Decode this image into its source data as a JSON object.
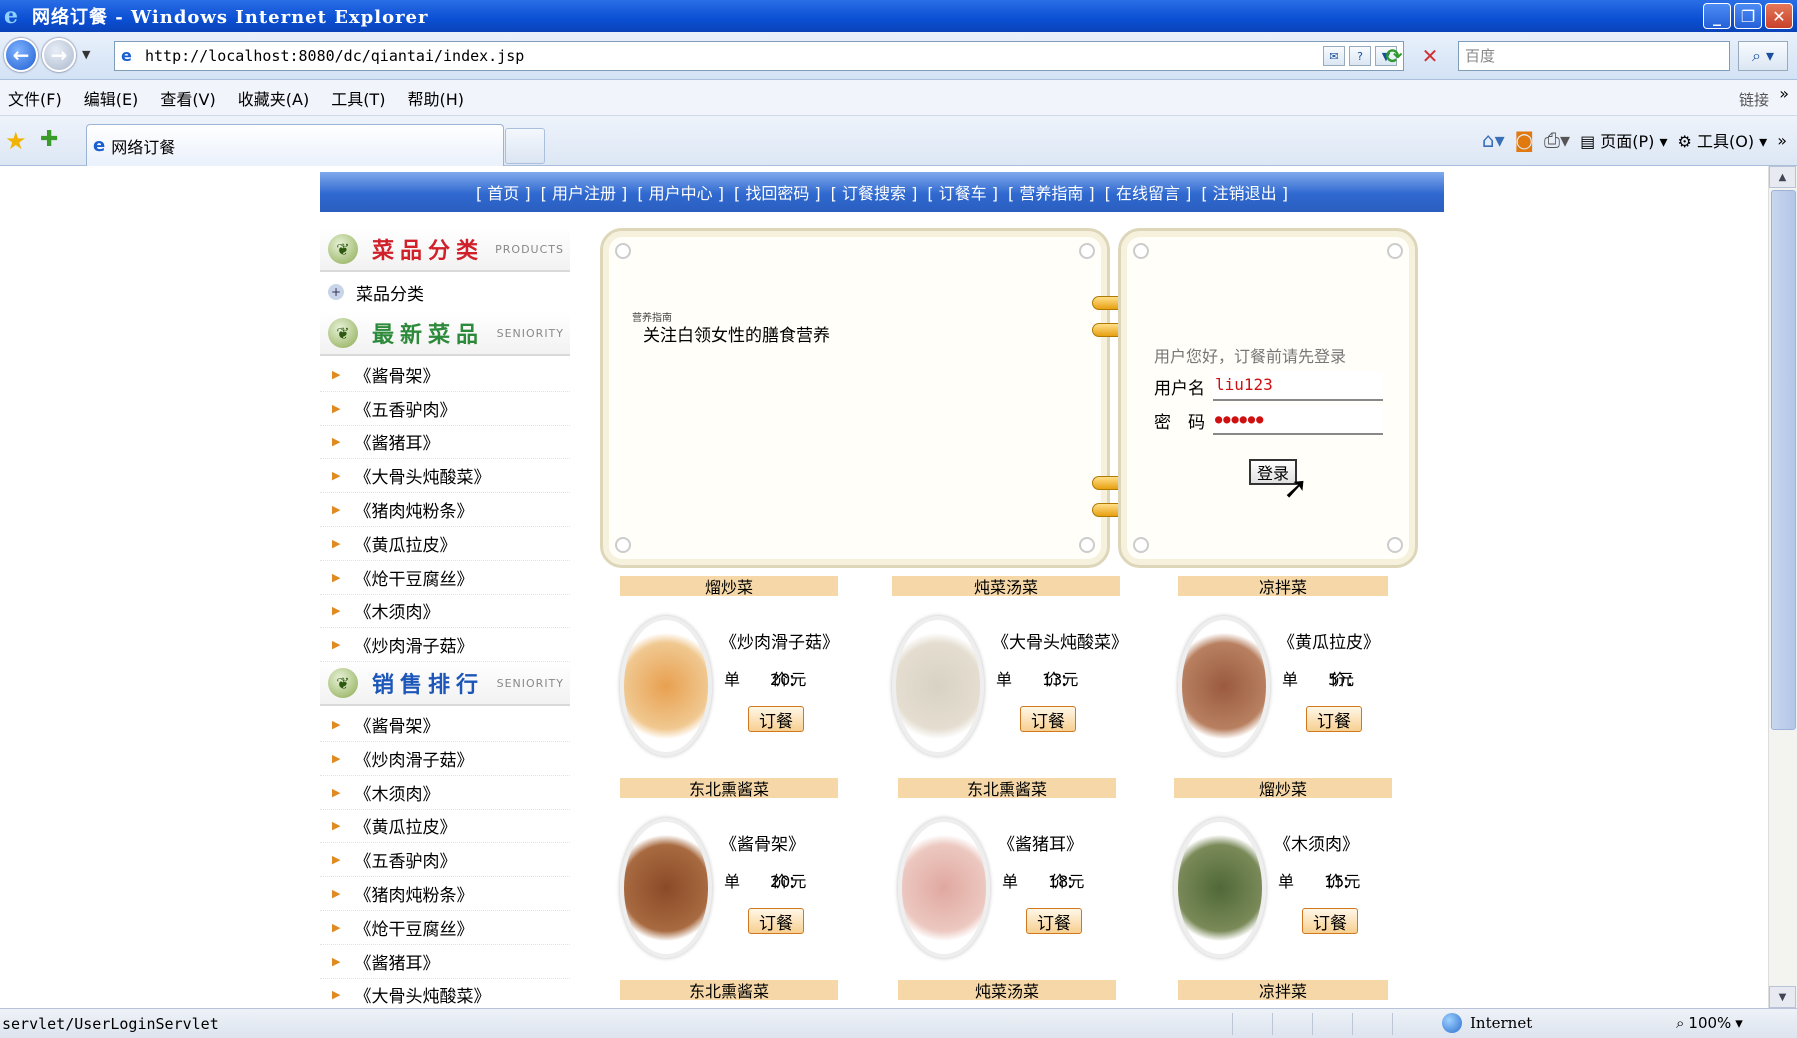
{
  "window": {
    "title": "网络订餐 - Windows Internet Explorer",
    "url": "http://localhost:8080/dc/qiantai/index.jsp",
    "search_placeholder": "百度",
    "links_label": "链接",
    "tab_title": "网络订餐",
    "menus": [
      "文件(F)",
      "编辑(E)",
      "查看(V)",
      "收藏夹(A)",
      "工具(T)",
      "帮助(H)"
    ],
    "page_menu": "页面(P)",
    "tools_menu": "工具(O)",
    "status_text": "servlet/UserLoginServlet",
    "status_zone": "Internet",
    "zoom": "100%"
  },
  "topnav": [
    "[ 首页 ]",
    "[ 用户注册 ]",
    "[ 用户中心 ]",
    "[ 找回密码 ]",
    "[ 订餐搜索 ]",
    "[ 订餐车 ]",
    "[ 营养指南 ]",
    "[ 在线留言 ]",
    "[ 注销退出 ]"
  ],
  "sidebar": {
    "categories": {
      "title": "菜品分类",
      "sub": "PRODUCTS",
      "item": "菜品分类"
    },
    "newest": {
      "title": "最新菜品",
      "sub": "SENIORITY",
      "items": [
        "《酱骨架》",
        "《五香驴肉》",
        "《酱猪耳》",
        "《大骨头炖酸菜》",
        "《猪肉炖粉条》",
        "《黄瓜拉皮》",
        "《炝干豆腐丝》",
        "《木须肉》",
        "《炒肉滑子菇》"
      ]
    },
    "ranking": {
      "title": "销售排行",
      "sub": "SENIORITY",
      "items": [
        "《酱骨架》",
        "《炒肉滑子菇》",
        "《木须肉》",
        "《黄瓜拉皮》",
        "《五香驴肉》",
        "《猪肉炖粉条》",
        "《炝干豆腐丝》",
        "《酱猪耳》",
        "《大骨头炖酸菜》"
      ]
    }
  },
  "notice": {
    "small_label": "营养指南",
    "text": "关注白领女性的膳食营养"
  },
  "login": {
    "hint": "用户您好，订餐前请先登录",
    "username_label": "用户名",
    "username_value": "liu123",
    "password_label": "密　码",
    "password_value": "●●●●●●",
    "button": "登录"
  },
  "food": {
    "price_label": "单　　价：",
    "order_button": "订餐",
    "row1": [
      {
        "category": "熘炒菜",
        "name": "《炒肉滑子菇》",
        "price": "20元",
        "plate_color": "#e8a050"
      },
      {
        "category": "炖菜汤菜",
        "name": "《大骨头炖酸菜》",
        "price": "13元",
        "plate_color": "#d8d2c4"
      },
      {
        "category": "凉拌菜",
        "name": "《黄瓜拉皮》",
        "price": "5元",
        "plate_color": "#9a5a40"
      }
    ],
    "row2": [
      {
        "category": "东北熏酱菜",
        "name": "《酱骨架》",
        "price": "20元",
        "plate_color": "#8a4a28"
      },
      {
        "category": "东北熏酱菜",
        "name": "《酱猪耳》",
        "price": "18元",
        "plate_color": "#e0a8a0"
      },
      {
        "category": "熘炒菜",
        "name": "《木须肉》",
        "price": "15元",
        "plate_color": "#506838"
      }
    ],
    "row3_categories": [
      "东北熏酱菜",
      "炖菜汤菜",
      "凉拌菜"
    ]
  }
}
